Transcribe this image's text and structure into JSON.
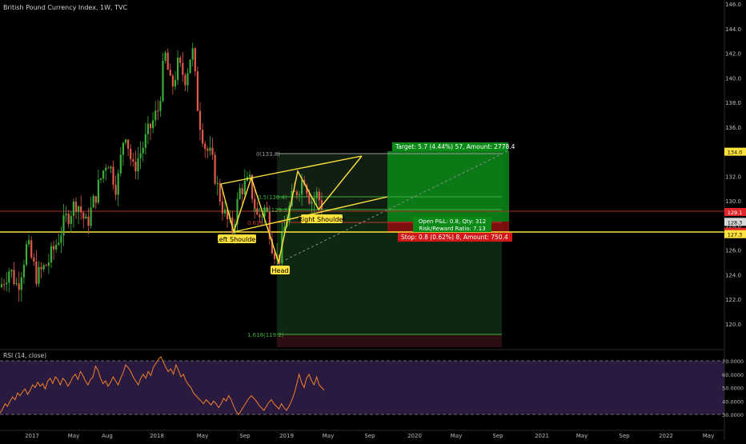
{
  "header": {
    "title": "British Pound Currency Index, 1W, TVC"
  },
  "rsi": {
    "label": "RSI (14, close)",
    "axis_ticks": [
      "70.0000",
      "60.0000",
      "50.0000",
      "40.0000",
      "30.0000"
    ],
    "levels": [
      70,
      30
    ],
    "color": "#f0802a",
    "band_color": "#2a1a3f"
  },
  "colors": {
    "up": "#3dae3d",
    "down": "#e05a4c",
    "pattern": "#ffe23c",
    "target_zone": "#0b8a17",
    "stop_zone": "#8b1010",
    "fib_zone": "#17321a"
  },
  "price_axis": {
    "ticks": [
      "146.0",
      "144.0",
      "142.0",
      "140.0",
      "138.0",
      "136.0",
      "134.0",
      "132.0",
      "130.0",
      "128.0",
      "126.0",
      "124.0",
      "122.0",
      "120.0"
    ],
    "tags": [
      {
        "text": "134.0",
        "value": 134.0,
        "bg": "#ffe23c",
        "fg": "#000000"
      },
      {
        "text": "129.1",
        "value": 129.1,
        "bg": "#e0262a",
        "fg": "#ffffff"
      },
      {
        "text": "128.3",
        "value": 128.3,
        "bg": "#d8d8d8",
        "fg": "#000000"
      },
      {
        "text": "127.5",
        "value": 127.5,
        "bg": "#e0262a",
        "fg": "#ffffff"
      },
      {
        "text": "127.3",
        "value": 127.3,
        "bg": "#ffe23c",
        "fg": "#000000"
      }
    ]
  },
  "time_axis": {
    "ticks": [
      "2017",
      "May",
      "Aug",
      "2018",
      "May",
      "Sep",
      "2019",
      "May",
      "Sep",
      "2020",
      "May",
      "Sep",
      "2021",
      "May",
      "Sep",
      "2022",
      "May"
    ]
  },
  "annotations": {
    "left_shoulder": "Left Shoulder",
    "head": "Head",
    "right_shoulder": "Right Shoulder",
    "fib_0": "0(133.8)",
    "fib_05": "0.5(130.4)",
    "fib_0618_a": "0.618(129.3)",
    "fib_0618_b": "0.618",
    "fib_1618": "1.618(119.2)",
    "target": "Target: 5.7 (4.44%) 57, Amount: 2778.4",
    "open_pl": "Open P&L: 0.8, Qty: 312",
    "risk_reward": "Risk/Reward Ratio: 7.13",
    "stop": "Stop: 0.8 (0.62%) 8, Amount: 750.4"
  },
  "chart_data": {
    "type": "candlestick",
    "title": "British Pound Currency Index, 1W, TVC",
    "ylim": [
      118.5,
      146.0
    ],
    "horizontal_lines": [
      127.5
    ],
    "pattern_points": {
      "left_shoulder": 127.5,
      "head": 124.9,
      "right_shoulder": 129.2,
      "neckline_high": 133.8
    },
    "position": {
      "entry": 128.3,
      "target": 134.0,
      "stop": 127.5
    },
    "fib_levels": [
      {
        "ratio": 0,
        "price": 133.8
      },
      {
        "ratio": 0.5,
        "price": 130.4
      },
      {
        "ratio": 0.618,
        "price": 129.3
      },
      {
        "ratio": 1.618,
        "price": 119.2
      }
    ],
    "rsi": {
      "period": 14,
      "source": "close",
      "ylim": [
        25,
        75
      ],
      "values": [
        31,
        34,
        38,
        36,
        40,
        43,
        41,
        46,
        44,
        47,
        49,
        45,
        48,
        52,
        50,
        54,
        51,
        53,
        49,
        55,
        57,
        53,
        58,
        56,
        52,
        57,
        55,
        51,
        54,
        58,
        60,
        56,
        62,
        59,
        55,
        52,
        56,
        58,
        66,
        63,
        57,
        53,
        55,
        51,
        54,
        58,
        55,
        52,
        57,
        61,
        67,
        65,
        62,
        58,
        55,
        52,
        57,
        60,
        57,
        62,
        59,
        65,
        68,
        71,
        73,
        69,
        65,
        62,
        64,
        60,
        67,
        63,
        58,
        60,
        55,
        52,
        50,
        46,
        44,
        42,
        40,
        38,
        41,
        39,
        37,
        40,
        38,
        35,
        38,
        42,
        40,
        44,
        41,
        36,
        32,
        30,
        33,
        36,
        39,
        42,
        44,
        42,
        40,
        37,
        35,
        33,
        36,
        39,
        41,
        38,
        36,
        34,
        38,
        35,
        33,
        36,
        40,
        45,
        52,
        60,
        54,
        50,
        57,
        60,
        55,
        52,
        58,
        52,
        50,
        48
      ],
      "levels": [
        70,
        30
      ]
    }
  }
}
